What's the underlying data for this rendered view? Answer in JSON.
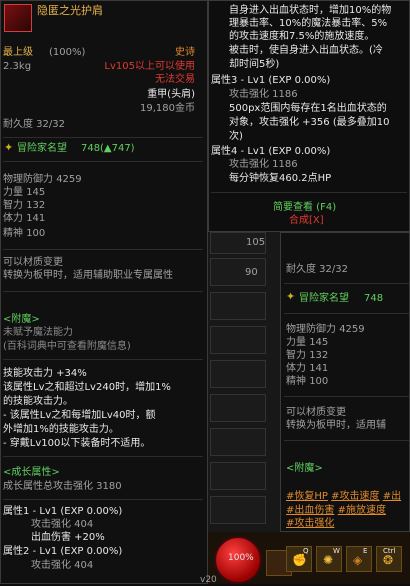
{
  "left": {
    "item_name": "隐匿之光护肩",
    "level_label": "最上级",
    "level_percent": "(100%)",
    "rarity": "史诗",
    "weight": "2.3kg",
    "level_requirement": "Lv105以上可以使用",
    "trade_status": "无法交易",
    "equip_type": "重甲(头肩)",
    "price": "19,180金币",
    "durability": "耐久度 32/32",
    "reputation_label": "冒险家名望",
    "reputation_value": "748",
    "reputation_diff": "(▲747)",
    "stats": [
      {
        "label": "物理防御力",
        "value": "4259"
      },
      {
        "label": "力量",
        "value": "145"
      },
      {
        "label": "智力",
        "value": "132"
      },
      {
        "label": "体力",
        "value": "141"
      },
      {
        "label": "精神",
        "value": "100"
      }
    ],
    "material_change_1": "可以材质变更",
    "material_change_2": "转换为板甲时，适用辅助职业专属属性",
    "enchant_header": "<附魔>",
    "enchant_none": "未赋予魔法能力",
    "enchant_hint": "(百科词典中可查看附魔信息)",
    "skill_lines": [
      "技能攻击力 +34%",
      "该属性Lv之和超过Lv240时，增加1%",
      "的技能攻击力。",
      "- 该属性Lv之和每增加Lv40时，额",
      "外增加1%的技能攻击力。",
      "- 穿戴Lv100以下装备时不适用。"
    ],
    "growth_header": "<成长属性>",
    "growth_total": "成长属性总攻击强化 3180",
    "growth_attrs": [
      {
        "title": "属性1 - Lv1 (EXP 0.00%)",
        "lines": [
          "攻击强化 404",
          "出血伤害 +20%"
        ]
      },
      {
        "title": "属性2 - Lv1 (EXP 0.00%)",
        "lines": [
          "攻击强化 404"
        ]
      }
    ]
  },
  "right_top": {
    "desc_lines": [
      "自身进入出血状态时，增加10%的物",
      "理暴击率、10%的魔法暴击率、5%",
      "的攻击速度和7.5%的施放速度。",
      "被击时，使自身进入出血状态。(冷",
      "却时间5秒)"
    ],
    "attr3_title": "属性3 - Lv1 (EXP 0.00%)",
    "attr3_line1": "攻击强化 1186",
    "attr3_desc": [
      "500px范围内每存在1名出血状态的",
      "对象，攻击强化 +356 (最多叠加10",
      "次)"
    ],
    "attr4_title": "属性4 - Lv1 (EXP 0.00%)",
    "attr4_line1": "攻击强化 1186",
    "attr4_line2": "每分钟恢复460.2点HP",
    "brief_view": "简要查看 (F4)",
    "synthesis": "合成[X]"
  },
  "right_bottom": {
    "durability": "耐久度 32/32",
    "reputation_label": "冒险家名望",
    "reputation_value": "748",
    "stats": [
      {
        "label": "物理防御力",
        "value": "4259"
      },
      {
        "label": "力量",
        "value": "145"
      },
      {
        "label": "智力",
        "value": "132"
      },
      {
        "label": "体力",
        "value": "141"
      },
      {
        "label": "精神",
        "value": "100"
      }
    ],
    "material_change_1": "可以材质变更",
    "material_change_2": "转换为板甲时，适用辅",
    "enchant_header": "<附魔>",
    "tags_row1": [
      "#恢复HP",
      "#攻击速度",
      "#出"
    ],
    "tags_row2": [
      "#出血伤害",
      "#施放速度"
    ],
    "tags_row3": [
      "#攻击强化"
    ]
  },
  "middle": {
    "num1": "105",
    "num2": "90"
  },
  "hud": {
    "hp_percent": "100%",
    "level_fragment": "v20",
    "keys": [
      "Q",
      "W",
      "E",
      "Ctrl"
    ]
  }
}
